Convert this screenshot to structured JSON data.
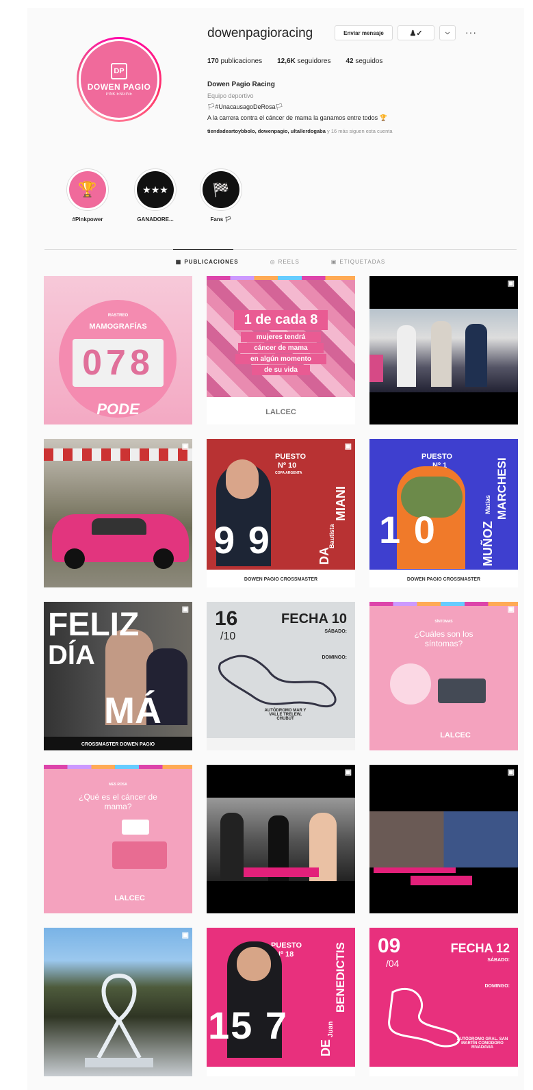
{
  "profile": {
    "username": "dowenpagioracing",
    "message_button": "Enviar mensaje",
    "follow_icon": "person-check-icon",
    "more_icon": "chevron-down-icon",
    "options_icon": "ellipsis-icon",
    "avatar_brand": "DOWEN PAGIO",
    "avatar_sub": "PINK ENGINE",
    "posts_count": "170",
    "posts_label": "publicaciones",
    "followers_count": "12,6K",
    "followers_label": "seguidores",
    "following_count": "42",
    "following_label": "seguidos",
    "name": "Dowen Pagio Racing",
    "category": "Equipo deportivo",
    "bio_line1": "🏳#UnacausagoDeRosa🏳",
    "bio_line2": "A la carrera contra el cáncer de mama la ganamos entre todos 🏆",
    "followed_by": "tiendadeartoybbolo, dowenpagio, ultallerdogaba",
    "followed_more": "y 16 más siguen esta cuenta"
  },
  "highlights": [
    {
      "label": "#Pinkpower",
      "icon": "trophy-icon",
      "color": "#f06a9b"
    },
    {
      "label": "GANADORE...",
      "icon": "podium-icon",
      "color": "#111111"
    },
    {
      "label": "Fans 🏳",
      "icon": "checkered-flags-icon",
      "color": "#111111"
    }
  ],
  "tabs": [
    {
      "label": "PUBLICACIONES",
      "icon": "grid-icon",
      "active": true
    },
    {
      "label": "REELS",
      "icon": "reels-icon",
      "active": false
    },
    {
      "label": "ETIQUETADAS",
      "icon": "tag-icon",
      "active": false
    }
  ],
  "posts": {
    "p1": {
      "small": "RASTREO",
      "title": "MAMOGRAFÍAS",
      "digits": "078",
      "footer": "PODE"
    },
    "p2": {
      "line1": "1 de cada 8",
      "line2": "mujeres tendrá",
      "line3": "cáncer de mama",
      "line4": "en algún momento",
      "line5": "de su vida",
      "logo": "LALCEC"
    },
    "p5": {
      "puesto": "PUESTO",
      "num": "Nº 10",
      "sub": "COPA ARGENTA",
      "big": "9  9",
      "first": "Bautista",
      "last": "MIANI",
      "prefix": "DA",
      "footer": "DOWEN PAGIO  CROSSMASTER"
    },
    "p6": {
      "puesto": "PUESTO",
      "num": "Nº 1",
      "big": "1  0",
      "first": "Matías",
      "last": "MARCHESI",
      "prefix": "MUÑOZ",
      "footer": "DOWEN PAGIO  CROSSMASTER"
    },
    "p7": {
      "line1": "FELIZ",
      "line2": "DÍA",
      "line3": "MÁ",
      "footer": "CROSSMASTER   DOWEN PAGIO"
    },
    "p8": {
      "day": "16",
      "month": "/10",
      "title": "FECHA 10",
      "sat": "SÁBADO:",
      "sun": "DOMINGO:",
      "place": "AUTÓDROMO MAR Y VALLE TRELEW, CHUBUT"
    },
    "p9": {
      "small": "SÍNTOMAS",
      "title": "¿Cuáles son los síntomas?",
      "logo": "LALCEC"
    },
    "p10": {
      "small": "MES ROSA",
      "title": "¿Qué es el cáncer de mama?",
      "logo": "LALCEC"
    },
    "p15": {
      "day": "09",
      "month": "/04",
      "title": "FECHA 12",
      "sat": "SÁBADO:",
      "sun": "DOMINGO:",
      "place": "AUTÓDROMO GRAL. SAN MARTÍN COMODORO RIVADAVIA"
    },
    "p14": {
      "puesto": "PUESTO",
      "num": "Nº 18",
      "big": "15  7",
      "first": "Juan",
      "last": "BENEDICTIS",
      "prefix": "DE"
    }
  }
}
